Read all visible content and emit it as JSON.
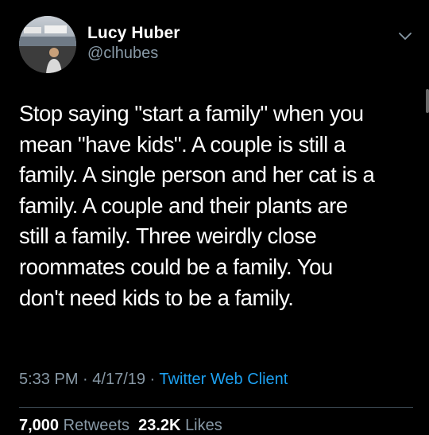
{
  "author": {
    "display_name": "Lucy Huber",
    "handle": "@clhubes"
  },
  "tweet": {
    "lines": [
      "Stop saying \"start a family\" when you",
      "mean \"have kids\". A couple is still a",
      "family. A single person and her cat is a",
      "family. A couple and their plants are",
      "still a family. Three weirdly close",
      "roommates could be a family. You",
      "don't need kids to be a family."
    ]
  },
  "meta": {
    "time": "5:33 PM",
    "separator": " · ",
    "date": "4/17/19",
    "client": "Twitter Web Client"
  },
  "stats": {
    "retweets_count": "7,000",
    "retweets_label": "Retweets",
    "likes_count": "23.2K",
    "likes_label": "Likes"
  },
  "icons": {
    "caret": "chevron-down-icon"
  },
  "colors": {
    "background": "#000000",
    "text": "#ffffff",
    "secondary": "#8899a6",
    "link": "#1da1f2"
  }
}
